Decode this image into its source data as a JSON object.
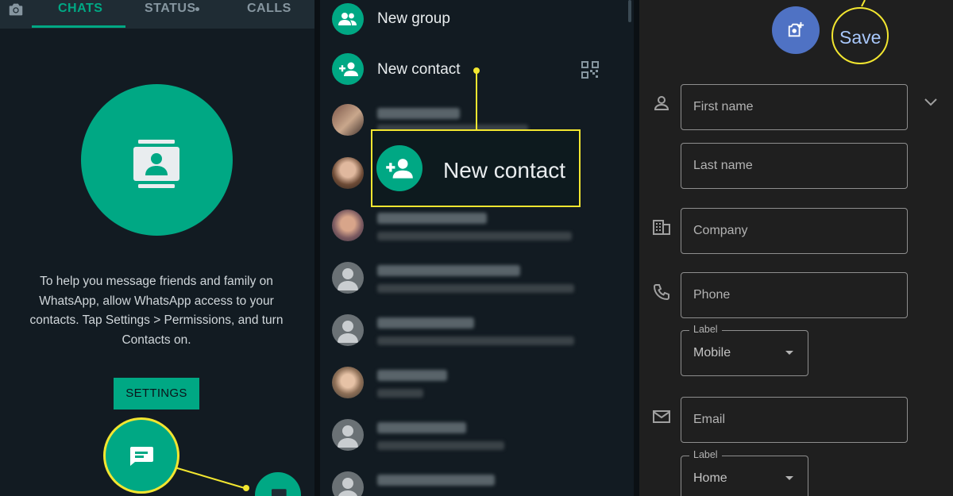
{
  "left_panel": {
    "tabs": [
      {
        "label": "CHATS",
        "active": true
      },
      {
        "label": "STATUS",
        "has_dot": true
      },
      {
        "label": "CALLS"
      }
    ],
    "icons": {
      "camera": "camera-icon",
      "contacts": "contacts-icon",
      "new_chat": "new-chat-icon"
    },
    "help_text": "To help you message friends and family on WhatsApp, allow WhatsApp access to your contacts. Tap Settings > Permissions, and turn Contacts on.",
    "settings_label": "SETTINGS"
  },
  "middle_panel": {
    "new_group": "New group",
    "new_contact": "New contact",
    "qr_icon": "qr-code-icon",
    "callout_label": "New contact",
    "contacts_count_visible": 8
  },
  "right_panel": {
    "save_label": "Save",
    "add_photo_icon": "add-photo-icon",
    "fields": {
      "first_name_placeholder": "First name",
      "last_name_placeholder": "Last name",
      "company_placeholder": "Company",
      "phone_placeholder": "Phone",
      "phone_label_caption": "Label",
      "phone_label_value": "Mobile",
      "email_placeholder": "Email",
      "email_label_caption": "Label",
      "email_label_value": "Home"
    }
  },
  "colors": {
    "accent_green": "#00a884",
    "highlight_yellow": "#f2e630",
    "save_blue": "#a8c7fa",
    "photo_button": "#4f72c4"
  }
}
